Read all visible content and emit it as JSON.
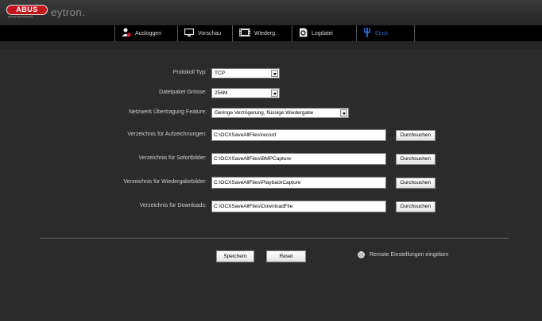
{
  "brand": {
    "logo": "ABUS",
    "logo_tagline": "Security Tech Germany",
    "product": "eytron."
  },
  "nav": [
    {
      "label": "Ausloggen",
      "icon": "user-logout-icon"
    },
    {
      "label": "Vorschau",
      "icon": "monitor-icon"
    },
    {
      "label": "Wiederg.",
      "icon": "film-icon"
    },
    {
      "label": "Logdatei",
      "icon": "log-file-icon"
    },
    {
      "label": "Einst.",
      "icon": "settings-fork-icon",
      "active": true
    }
  ],
  "form": {
    "protocol": {
      "label": "Protokoll Typ:",
      "value": "TCP"
    },
    "packet": {
      "label": "Dateipaket Grösse:",
      "value": "256M"
    },
    "network": {
      "label": "Netzwerk Übertragung Feature:",
      "value": "Geringe Verzögerung, flüssige Wiedergabe"
    },
    "rec_dir": {
      "label": "Verzeichnis für Aufzeichnungen:",
      "value": "C:\\OCXSaveAllFiles\\record"
    },
    "snap_dir": {
      "label": "Verzeichnis für Sofortbilder:",
      "value": "C:\\OCXSaveAllFiles\\BMPCapture"
    },
    "play_dir": {
      "label": "Verzeichnis für Wiedergabebilder:",
      "value": "C:\\OCXSaveAllFiles\\PlaybackCapture"
    },
    "dl_dir": {
      "label": "Verzeichnis für Downloads:",
      "value": "C:\\OCXSaveAllFiles\\DownloadFile"
    },
    "browse_label": "Durchsuchen"
  },
  "actions": {
    "save": "Speichern",
    "reset": "Reset",
    "remote": "Remote Einstellungen eingeben"
  },
  "colors": {
    "brand_red": "#c4151c",
    "active_nav": "#2a5fc9",
    "background": "#2b2b2b"
  }
}
